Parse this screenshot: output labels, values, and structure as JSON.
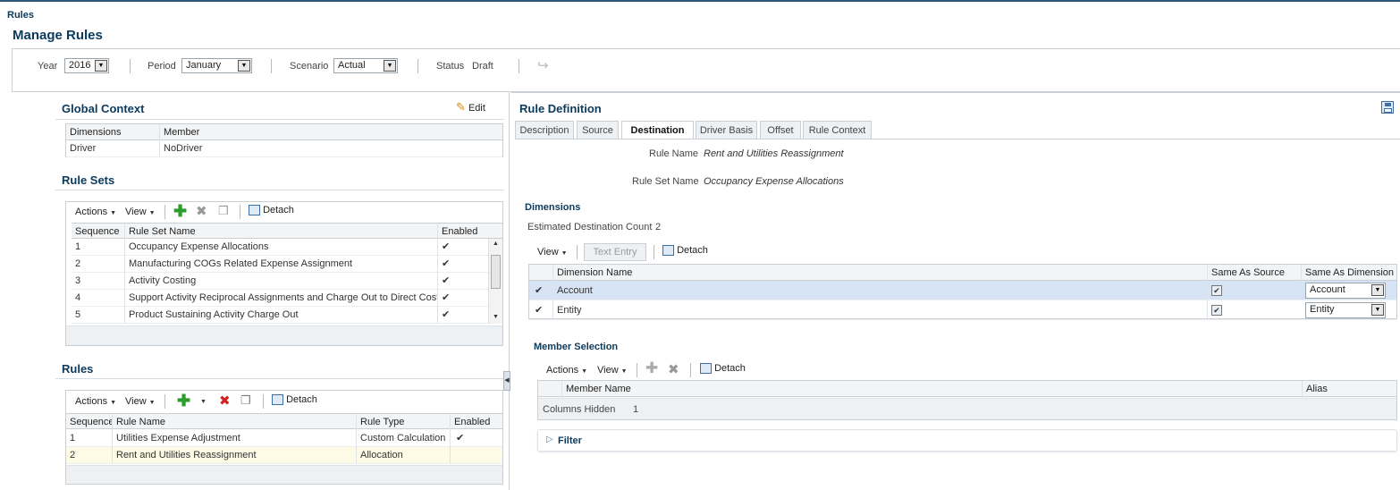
{
  "header": {
    "breadcrumb": "Rules",
    "title": "Manage Rules"
  },
  "filters": {
    "year_label": "Year",
    "year_value": "2016",
    "period_label": "Period",
    "period_value": "January",
    "scenario_label": "Scenario",
    "scenario_value": "Actual",
    "status_label": "Status",
    "status_value": "Draft"
  },
  "global_context": {
    "title": "Global Context",
    "edit_label": "Edit",
    "columns": [
      "Dimensions",
      "Member"
    ],
    "rows": [
      {
        "dimension": "Driver",
        "member": "NoDriver"
      }
    ]
  },
  "rule_sets": {
    "title": "Rule Sets",
    "actions_label": "Actions",
    "view_label": "View",
    "detach_label": "Detach",
    "columns": [
      "Sequence",
      "Rule Set Name",
      "Enabled"
    ],
    "rows": [
      {
        "seq": "1",
        "name": "Occupancy Expense Allocations",
        "enabled": "✔"
      },
      {
        "seq": "2",
        "name": "Manufacturing COGs Related Expense Assignment",
        "enabled": "✔"
      },
      {
        "seq": "3",
        "name": "Activity Costing",
        "enabled": "✔"
      },
      {
        "seq": "4",
        "name": "Support Activity Reciprocal Assignments and Charge Out to Direct Cost Centers",
        "enabled": "✔"
      },
      {
        "seq": "5",
        "name": "Product Sustaining Activity Charge Out",
        "enabled": "✔"
      }
    ]
  },
  "rules": {
    "title": "Rules",
    "actions_label": "Actions",
    "view_label": "View",
    "detach_label": "Detach",
    "columns": [
      "Sequence",
      "Rule Name",
      "Rule Type",
      "Enabled"
    ],
    "rows": [
      {
        "seq": "1",
        "name": "Utilities Expense Adjustment",
        "type": "Custom Calculation",
        "enabled": "✔"
      },
      {
        "seq": "2",
        "name": "Rent and Utilities Reassignment",
        "type": "Allocation",
        "enabled": ""
      }
    ]
  },
  "rule_definition": {
    "title": "Rule Definition",
    "tabs": [
      "Description",
      "Source",
      "Destination",
      "Driver Basis",
      "Offset",
      "Rule Context"
    ],
    "active_tab": "Destination",
    "rule_name_label": "Rule Name",
    "rule_name_value": "Rent and Utilities Reassignment",
    "rule_set_name_label": "Rule Set Name",
    "rule_set_name_value": "Occupancy Expense Allocations",
    "dimensions_title": "Dimensions",
    "estimated_label": "Estimated Destination Count",
    "estimated_value": "2",
    "view_label": "View",
    "text_entry_label": "Text Entry",
    "detach_label": "Detach",
    "dim_columns": [
      "Dimension Name",
      "Same As Source",
      "Same As Dimension"
    ],
    "dim_rows": [
      {
        "mark": "✔",
        "name": "Account",
        "same_as_source": "✔",
        "same_as_dimension": "Account"
      },
      {
        "mark": "✔",
        "name": "Entity",
        "same_as_source": "✔",
        "same_as_dimension": "Entity"
      }
    ],
    "member_selection_title": "Member Selection",
    "ms_actions_label": "Actions",
    "ms_view_label": "View",
    "ms_detach_label": "Detach",
    "ms_columns": [
      "Member Name",
      "Alias"
    ],
    "columns_hidden_label": "Columns Hidden",
    "columns_hidden_value": "1",
    "filter_label": "Filter"
  },
  "colors": {
    "accent": "#0b3a5c",
    "selected_row": "#d5e3f4",
    "highlight_row": "#fdfbe6"
  }
}
